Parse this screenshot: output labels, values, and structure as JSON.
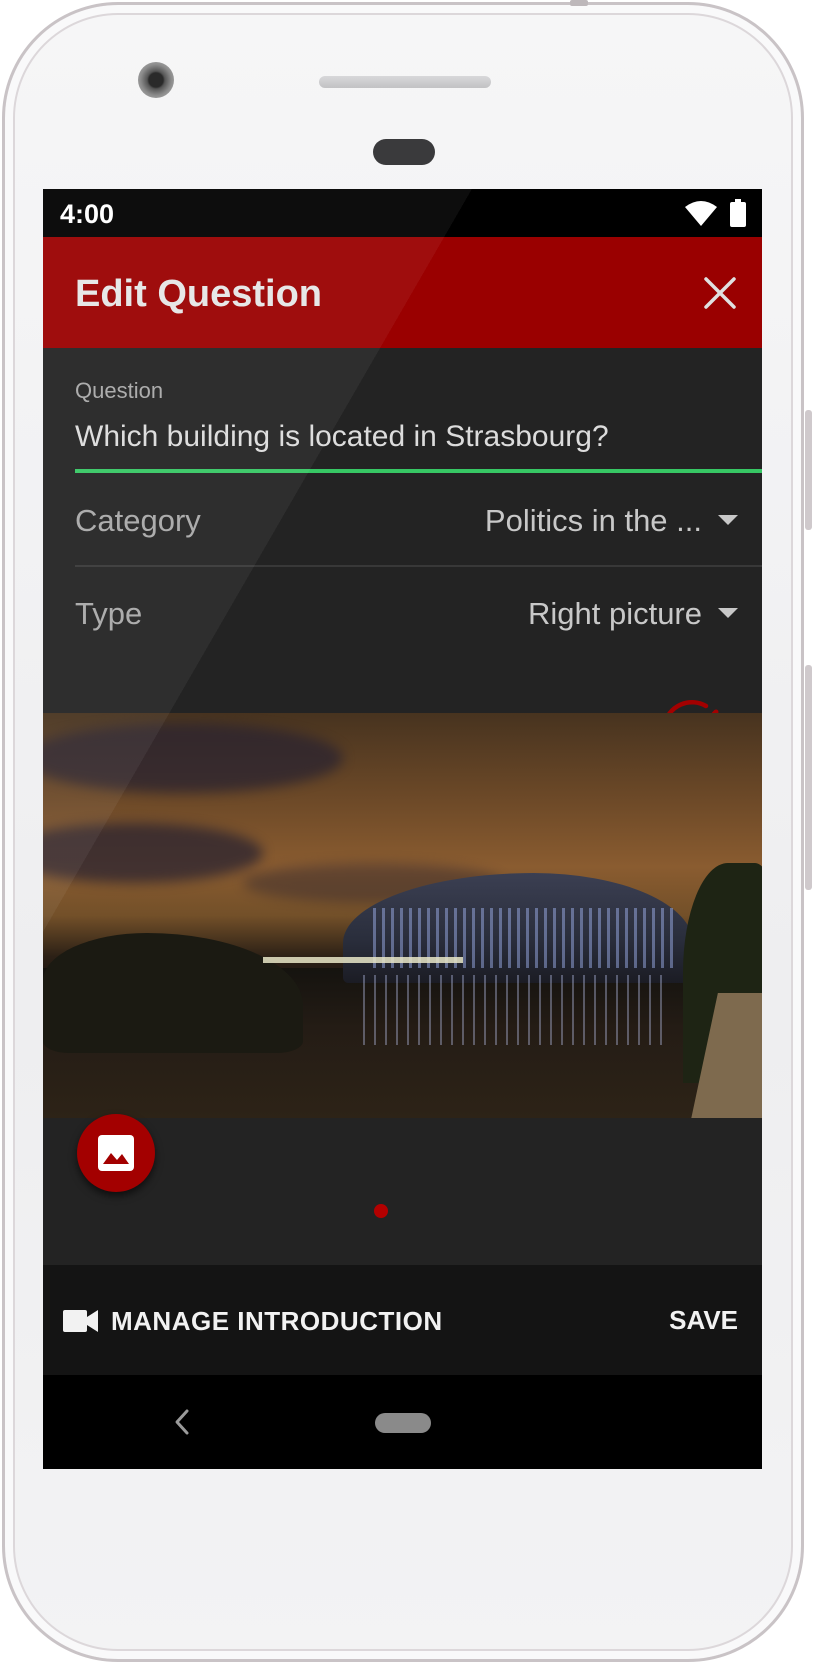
{
  "status_bar": {
    "time": "4:00",
    "wifi_icon": "wifi-icon",
    "battery_icon": "battery-icon"
  },
  "app_bar": {
    "title": "Edit Question",
    "close_icon": "close-icon",
    "color": "#9a0000"
  },
  "form": {
    "question": {
      "label": "Question",
      "value": "Which building is located in Strasbourg?"
    },
    "category": {
      "label": "Category",
      "value": "Politics in the ..."
    },
    "type": {
      "label": "Type",
      "value": "Right picture"
    },
    "accent_color": "#37c764"
  },
  "image_section": {
    "correct_icon": "check-circle-icon",
    "image_button_icon": "image-icon",
    "pager_selected_index": 0
  },
  "bottom_bar": {
    "manage_intro_label": "MANAGE INTRODUCTION",
    "manage_intro_icon": "videocam-icon",
    "save_label": "SAVE"
  },
  "nav_bar": {
    "back_icon": "back-icon",
    "home_icon": "home-pill-icon"
  }
}
